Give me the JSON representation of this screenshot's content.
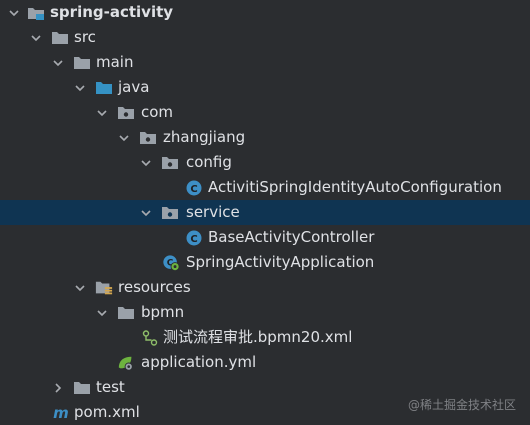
{
  "tree": {
    "root": "spring-activity",
    "src": "src",
    "main": "main",
    "java": "java",
    "com": "com",
    "zhangjiang": "zhangjiang",
    "config": "config",
    "config_class": "ActivitiSpringIdentityAutoConfiguration",
    "service": "service",
    "service_class": "BaseActivityController",
    "app_class": "SpringActivityApplication",
    "resources": "resources",
    "bpmn": "bpmn",
    "bpmn_file": "测试流程审批.bpmn20.xml",
    "app_yml": "application.yml",
    "test": "test",
    "pom": "pom.xml"
  },
  "watermark": "@稀土掘金技术社区",
  "icons": {
    "root": "module-folder-icon",
    "folder": "folder-icon",
    "source-folder": "source-folder-icon",
    "package": "package-icon",
    "class": "class-icon",
    "spring-boot-class": "spring-boot-app-icon",
    "resources-folder": "resources-folder-icon",
    "bpmn": "bpmn-file-icon",
    "yml": "spring-config-icon",
    "maven": "maven-icon"
  },
  "colors": {
    "background": "#2b2d30",
    "selection": "#0f3452",
    "text": "#dfe1e5",
    "source_folder": "#3592c4",
    "class_icon": "#3d8fc6"
  }
}
